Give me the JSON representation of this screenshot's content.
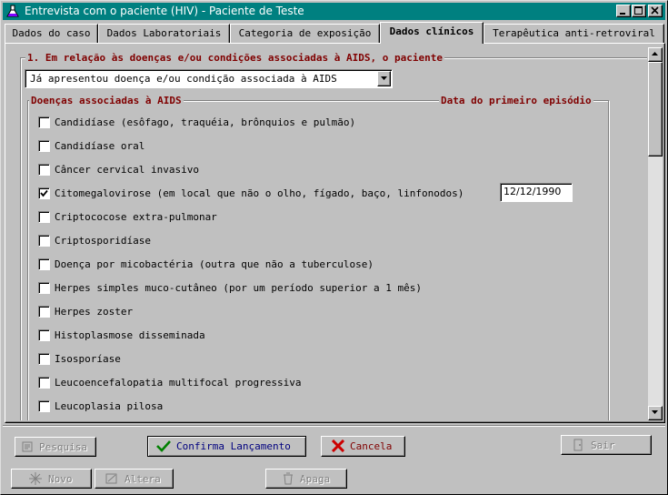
{
  "window": {
    "title": "Entrevista com o paciente (HIV) - Paciente de Teste",
    "app_icon": "flask-icon",
    "title_color": "#008080"
  },
  "tabs": [
    {
      "label": "Dados do caso",
      "active": false
    },
    {
      "label": "Dados Laboratoriais",
      "active": false
    },
    {
      "label": "Categoria de exposição",
      "active": false
    },
    {
      "label": "Dados clínicos",
      "active": true
    },
    {
      "label": "Terapêutica anti-retroviral",
      "active": false
    }
  ],
  "section1": {
    "legend": "1. Em relação às doenças e/ou condições associadas à AIDS, o paciente",
    "combo_value": "Já apresentou doença e/ou condição associada à AIDS",
    "diseases_header": "Doenças associadas à AIDS",
    "date_header": "Data do primeiro episódio",
    "items": [
      {
        "label": "Candidíase (esôfago, traquéia, brônquios e pulmão)",
        "checked": false,
        "date": ""
      },
      {
        "label": "Candidíase oral",
        "checked": false,
        "date": ""
      },
      {
        "label": "Câncer cervical invasivo",
        "checked": false,
        "date": ""
      },
      {
        "label": "Citomegalovirose (em local que não o olho, fígado, baço, linfonodos)",
        "checked": true,
        "date": "12/12/1990"
      },
      {
        "label": "Criptococose extra-pulmonar",
        "checked": false,
        "date": ""
      },
      {
        "label": "Criptosporidíase",
        "checked": false,
        "date": ""
      },
      {
        "label": "Doença por micobactéria (outra que não a tuberculose)",
        "checked": false,
        "date": ""
      },
      {
        "label": "Herpes simples muco-cutâneo (por um período superior a 1 mês)",
        "checked": false,
        "date": ""
      },
      {
        "label": "Herpes zoster",
        "checked": false,
        "date": ""
      },
      {
        "label": "Histoplasmose disseminada",
        "checked": false,
        "date": ""
      },
      {
        "label": "Isosporíase",
        "checked": false,
        "date": ""
      },
      {
        "label": "Leucoencefalopatia multifocal progressiva",
        "checked": false,
        "date": ""
      },
      {
        "label": "Leucoplasia pilosa",
        "checked": false,
        "date": ""
      }
    ]
  },
  "buttons_row1": {
    "pesquisa": {
      "label": "Pesquisa",
      "enabled": false,
      "icon": "search-icon"
    },
    "confirma": {
      "label": "Confirma Lançamento",
      "enabled": true,
      "icon": "checkmark-icon"
    },
    "cancela": {
      "label": "Cancela",
      "enabled": true,
      "icon": "x-icon"
    },
    "sair": {
      "label": "Sair",
      "enabled": false,
      "icon": "door-icon"
    }
  },
  "buttons_row2": {
    "novo": {
      "label": "Novo",
      "enabled": false,
      "icon": "new-icon"
    },
    "altera": {
      "label": "Altera",
      "enabled": false,
      "icon": "edit-icon"
    },
    "apaga": {
      "label": "Apaga",
      "enabled": false,
      "icon": "trash-icon"
    }
  },
  "colors": {
    "legend": "#800000",
    "check": "#008000",
    "cancel": "#cc0000",
    "primary_text": "#00007f"
  }
}
